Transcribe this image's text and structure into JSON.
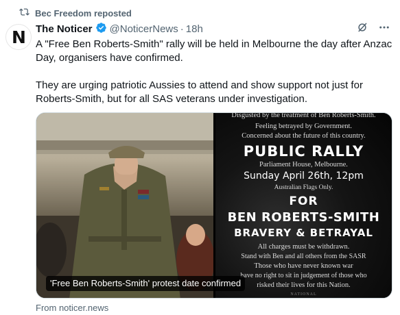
{
  "repost": {
    "label": "Bec Freedom reposted",
    "icon": "repost-icon"
  },
  "post": {
    "avatar_letter": "N",
    "author_name": "The Noticer",
    "handle": "@NoticerNews",
    "separator": "·",
    "time": "18h",
    "verified_color": "#1d9bf0",
    "paragraphs": [
      "A \"Free Ben Roberts-Smith\" rally will be held in Melbourne the day after Anzac Day, organisers have confirmed.",
      "They are urging patriotic Aussies to attend and show support not just for Roberts-Smith, but for all SAS veterans under investigation."
    ]
  },
  "card": {
    "caption": "'Free Ben Roberts-Smith' protest date confirmed",
    "poster": {
      "line1": "Disgusted by the treatment of Ben Roberts-Smith.",
      "line2": "Feeling betrayed by Government.",
      "line3": "Concerned about the future of this country.",
      "heading1": "PUBLIC  RALLY",
      "location": "Parliament House, Melbourne.",
      "date": "Sunday April 26th, 12pm",
      "flags": "Australian Flags Only.",
      "for": "FOR",
      "name": "BEN  ROBERTS-SMITH",
      "theme": "BRAVERY  &  BETRAYAL",
      "charges": "All charges must be withdrawn.",
      "stand": "Stand with Ben and all others from the SASR",
      "never": "Those who have never known war",
      "noright": "have no right to sit in judgement of those who",
      "risked": "risked their lives for this Nation.",
      "footer": "NATIONAL"
    },
    "source": "From noticer.news"
  }
}
